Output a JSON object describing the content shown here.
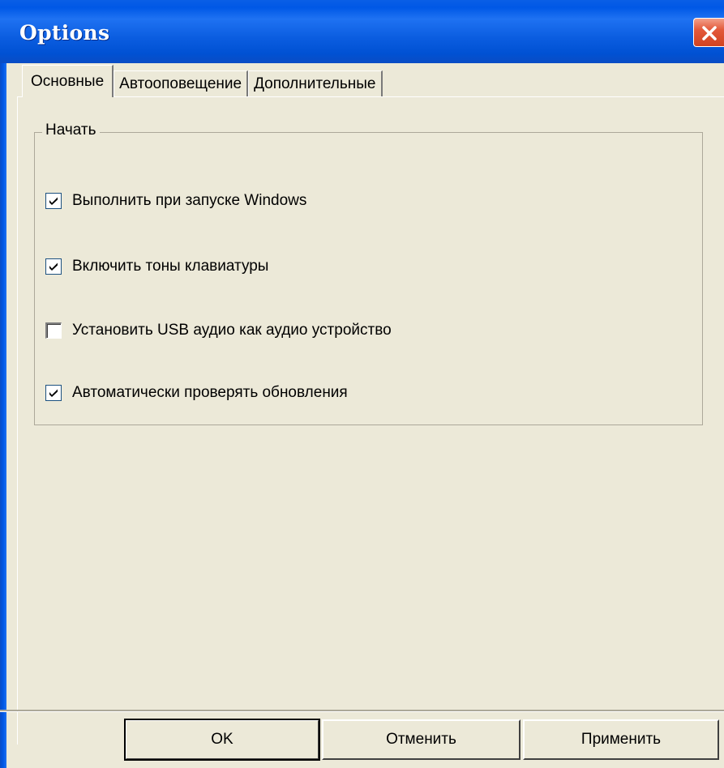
{
  "window": {
    "title": "Options",
    "accent_color": "#0058e6",
    "close_icon": "close-icon"
  },
  "tabs": [
    {
      "label": "Основные",
      "active": true
    },
    {
      "label": "Автооповещение",
      "active": false
    },
    {
      "label": "Дополнительные",
      "active": false
    }
  ],
  "group": {
    "label": "Начать",
    "options": [
      {
        "label": "Выполнить при запуске Windows",
        "checked": true
      },
      {
        "label": "Включить тоны клавиатуры",
        "checked": true
      },
      {
        "label": "Установить USB аудио как аудио устройство",
        "checked": false
      },
      {
        "label": "Автоматически проверять обновления",
        "checked": true
      }
    ]
  },
  "buttons": {
    "ok": "OK",
    "cancel": "Отменить",
    "apply": "Применить"
  }
}
